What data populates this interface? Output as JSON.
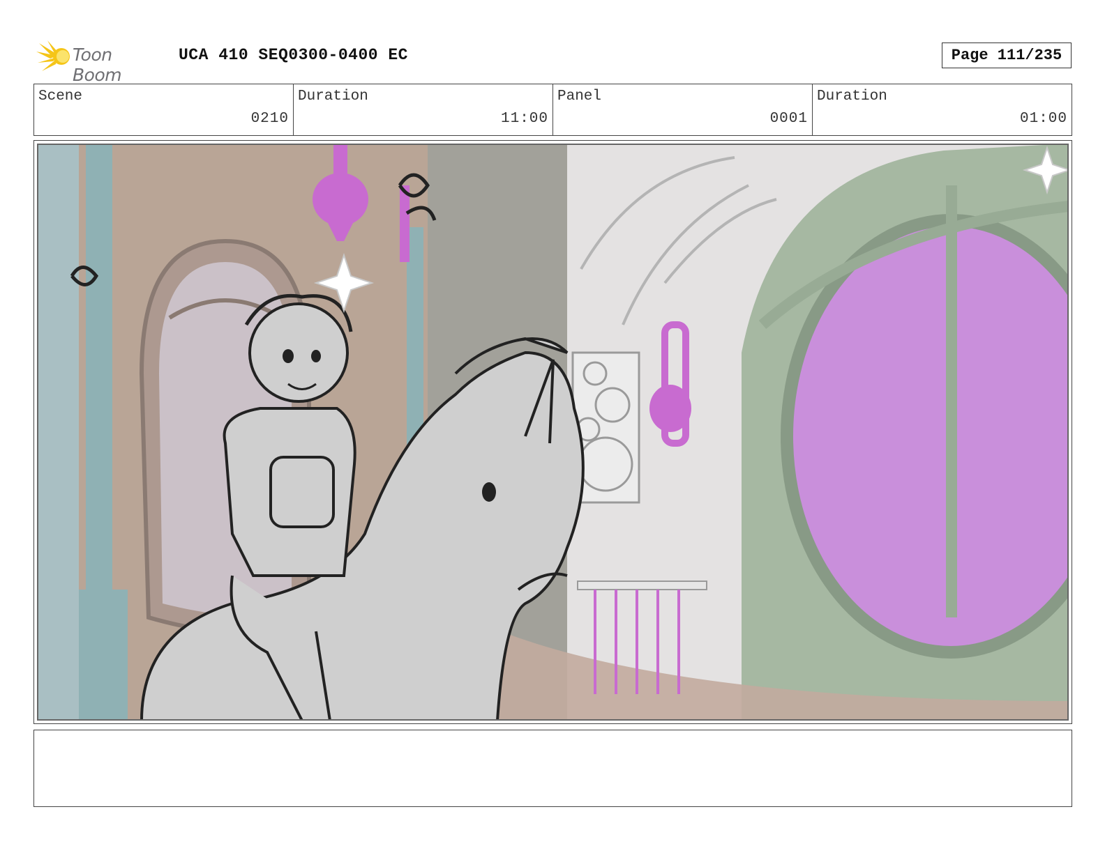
{
  "header": {
    "logo_text": "Toon Boom",
    "title": "UCA 410 SEQ0300-0400 EC",
    "page": "Page 111/235"
  },
  "info": {
    "scene_label": "Scene",
    "scene_value": "0210",
    "scene_duration_label": "Duration",
    "scene_duration_value": "11:00",
    "panel_label": "Panel",
    "panel_value": "0001",
    "panel_duration_label": "Duration",
    "panel_duration_value": "01:00"
  },
  "colors": {
    "logo_burst": "#f5c518",
    "wall_tan": "#b9a596",
    "pillar_teal": "#8fb1b4",
    "lamp_magenta": "#c86bd0",
    "window_purple": "#c98fdb",
    "frame_green": "#a6b8a2",
    "sketch_grey": "#cfcfcf"
  },
  "notes": {
    "text": ""
  }
}
